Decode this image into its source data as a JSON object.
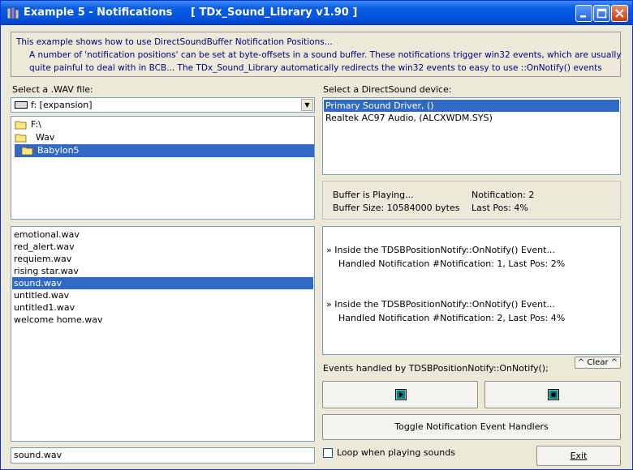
{
  "window": {
    "title": "Example 5 - Notifications",
    "subtitle": "[ TDx_Sound_Library v1.90 ]",
    "minimize": "_",
    "maximize": "□",
    "close": "✕"
  },
  "intro": {
    "line1": "This example shows how to use DirectSoundBuffer Notification Positions...",
    "line2": "A number of 'notification positions' can be set at byte-offsets in a sound buffer. These notifications trigger win32 events, which are usually",
    "line3": "quite painful to deal with in BCB... The TDx_Sound_Library automatically redirects the win32 events to easy to use ::OnNotify() events"
  },
  "file_select": {
    "label": "Select a .WAV file:",
    "drive_value": "f: [expansion]",
    "folders": [
      "F:\\",
      "Wav",
      "Babylon5"
    ],
    "selected_folder": "Babylon5",
    "files": [
      "emotional.wav",
      "red_alert.wav",
      "requiem.wav",
      "rising star.wav",
      "sound.wav",
      "untitled.wav",
      "untitled1.wav",
      "welcome home.wav"
    ],
    "selected_file": "sound.wav",
    "filename_value": "sound.wav"
  },
  "device_select": {
    "label": "Select a DirectSound device:",
    "devices": [
      "Primary Sound Driver, ()",
      "Realtek AC97 Audio, (ALCXWDM.SYS)"
    ]
  },
  "status": {
    "playing": "Buffer is Playing...",
    "buffer_size": "Buffer Size: 10584000 bytes",
    "notification": "Notification: 2",
    "last_pos": "Last Pos: 4%"
  },
  "event_log": {
    "lines": [
      "» Inside the TDSBPositionNotify::OnNotify() Event...",
      "Handled Notification #Notification: 1, Last Pos: 2%",
      "» Inside the TDSBPositionNotify::OnNotify() Event...",
      "Handled Notification #Notification: 2, Last Pos: 4%"
    ],
    "clear_label": "^ Clear ^",
    "caption": "Events handled by TDSBPositionNotify::OnNotify();"
  },
  "controls": {
    "play_icon": "play-icon",
    "stop_icon": "stop-icon",
    "toggle_label": "Toggle Notification Event Handlers",
    "loop_label": "Loop when playing sounds",
    "exit_label": "Exit"
  }
}
